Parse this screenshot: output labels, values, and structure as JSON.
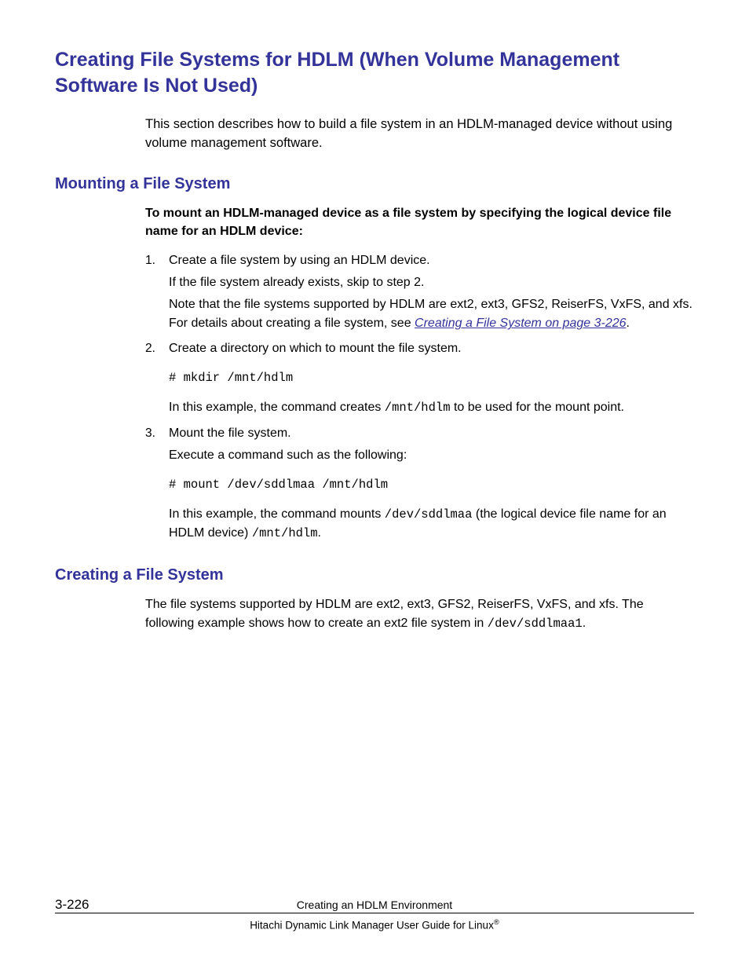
{
  "h1": "Creating File Systems for HDLM (When Volume Management Software Is Not Used)",
  "intro": "This section describes how to build a file system in an HDLM-managed device without using volume management software.",
  "section1": {
    "title": "Mounting a File System",
    "lead": "To mount an HDLM-managed device as a file system by specifying the logical device file name for an HDLM device:",
    "steps": {
      "s1": {
        "marker": "1.",
        "p1": "Create a file system by using an HDLM device.",
        "p2": "If the file system already exists, skip to step 2.",
        "p3a": "Note that the file systems supported by HDLM are ext2, ext3, GFS2, ReiserFS, VxFS, and xfs. For details about creating a file system, see ",
        "link": "Creating a File System on page 3-226",
        "p3b": "."
      },
      "s2": {
        "marker": "2.",
        "p1": "Create a directory on which to mount the file system.",
        "code": "# mkdir /mnt/hdlm",
        "p2a": "In this example, the command creates ",
        "p2code": "/mnt/hdlm",
        "p2b": " to be used for the mount point."
      },
      "s3": {
        "marker": "3.",
        "p1": "Mount the file system.",
        "p2": "Execute a command such as the following:",
        "code": "# mount /dev/sddlmaa /mnt/hdlm",
        "p3a": "In this example, the command mounts ",
        "p3code1": "/dev/sddlmaa",
        "p3b": " (the logical device file name for an HDLM device) ",
        "p3code2": "/mnt/hdlm",
        "p3c": "."
      }
    }
  },
  "section2": {
    "title": "Creating a File System",
    "p1a": "The file systems supported by HDLM are ext2, ext3, GFS2, ReiserFS, VxFS, and xfs. The following example shows how to create an ext2 file system in ",
    "p1code1": "/dev/sddlmaa1",
    "p1b": "."
  },
  "footer": {
    "page": "3-226",
    "chapter": "Creating an HDLM Environment",
    "book": "Hitachi Dynamic Link Manager User Guide for Linux"
  }
}
